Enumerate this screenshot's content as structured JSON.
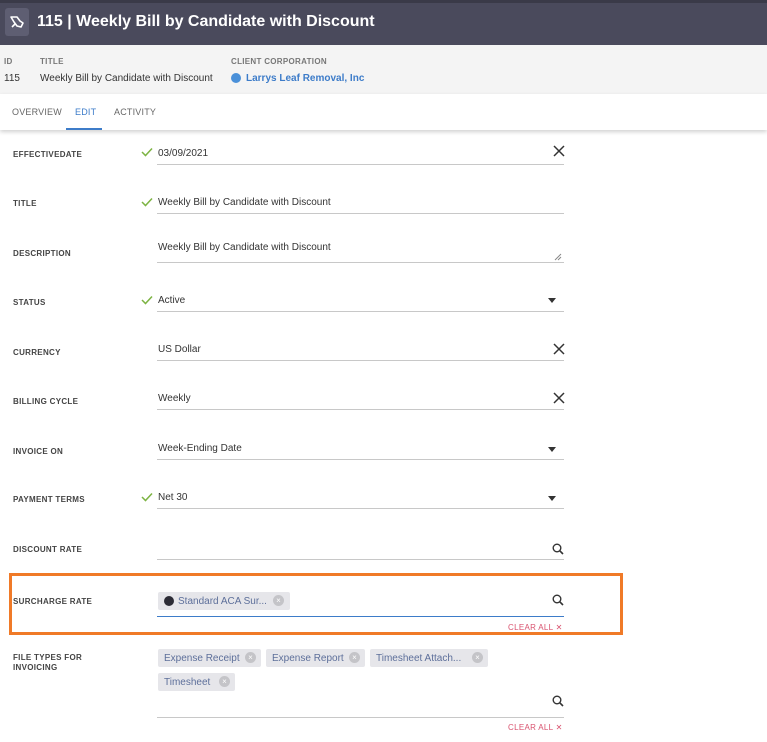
{
  "header": {
    "title": "115 | Weekly Bill by Candidate with Discount",
    "icon": "hand-bill-icon"
  },
  "meta": {
    "id_label": "ID",
    "id_value": "115",
    "title_label": "TITLE",
    "title_value": "Weekly Bill by Candidate with Discount",
    "client_label": "CLIENT CORPORATION",
    "client_value": "Larrys Leaf Removal, Inc"
  },
  "tabs": [
    {
      "label": "OVERVIEW",
      "active": false
    },
    {
      "label": "EDIT",
      "active": true
    },
    {
      "label": "ACTIVITY",
      "active": false
    }
  ],
  "form": {
    "effective_date": {
      "label": "EFFECTIVEDATE",
      "value": "03/09/2021"
    },
    "title": {
      "label": "TITLE",
      "value": "Weekly Bill by Candidate with Discount"
    },
    "description": {
      "label": "DESCRIPTION",
      "value": "Weekly Bill by Candidate with Discount"
    },
    "status": {
      "label": "STATUS",
      "value": "Active"
    },
    "currency": {
      "label": "CURRENCY",
      "value": "US Dollar"
    },
    "billing_cycle": {
      "label": "BILLING CYCLE",
      "value": "Weekly"
    },
    "invoice_on": {
      "label": "INVOICE ON",
      "value": "Week-Ending Date"
    },
    "payment_terms": {
      "label": "PAYMENT TERMS",
      "value": "Net 30"
    },
    "discount_rate": {
      "label": "DISCOUNT RATE",
      "value": ""
    },
    "surcharge_rate": {
      "label": "SURCHARGE RATE",
      "chip": "Standard ACA Sur...",
      "clear_all": "CLEAR ALL"
    },
    "file_types": {
      "label_line1": "FILE TYPES FOR",
      "label_line2": "INVOICING",
      "chips": [
        "Expense Receipt",
        "Expense Report",
        "Timesheet Attach...",
        "Timesheet"
      ],
      "clear_all": "CLEAR ALL"
    }
  },
  "colors": {
    "header_bg": "#4a4a5c",
    "accent": "#3d7cc9",
    "clear": "#d9536f",
    "highlight": "#f07a28",
    "check": "#7cb342"
  }
}
